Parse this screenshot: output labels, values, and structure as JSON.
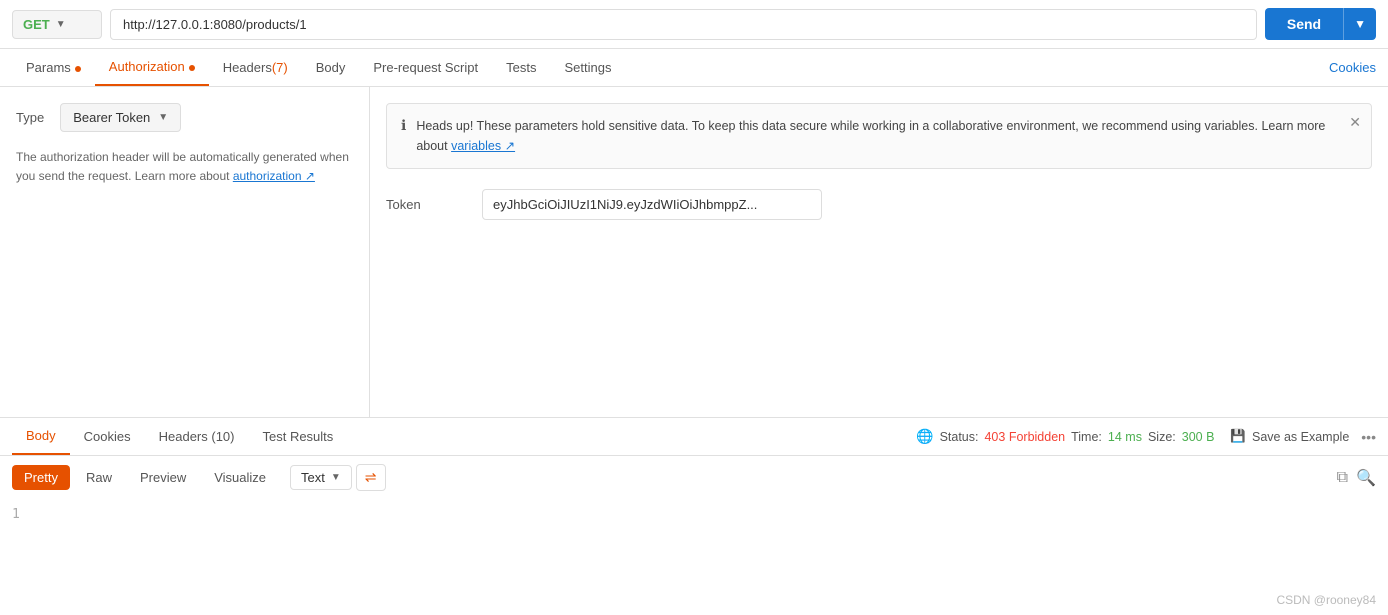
{
  "topbar": {
    "method": "GET",
    "url": "http://127.0.0.1:8080/products/1",
    "send_label": "Send"
  },
  "request_tabs": [
    {
      "id": "params",
      "label": "Params",
      "dot": "orange",
      "count": ""
    },
    {
      "id": "authorization",
      "label": "Authorization",
      "dot": "orange",
      "count": ""
    },
    {
      "id": "headers",
      "label": "Headers",
      "count": "(7)",
      "dot": ""
    },
    {
      "id": "body",
      "label": "Body",
      "dot": "",
      "count": ""
    },
    {
      "id": "prerequest",
      "label": "Pre-request Script",
      "dot": "",
      "count": ""
    },
    {
      "id": "tests",
      "label": "Tests",
      "dot": "",
      "count": ""
    },
    {
      "id": "settings",
      "label": "Settings",
      "dot": "",
      "count": ""
    }
  ],
  "cookies_link": "Cookies",
  "left_panel": {
    "type_label": "Type",
    "type_value": "Bearer Token",
    "description": "The authorization header will be automatically generated when you send the request. Learn more about ",
    "auth_link_text": "authorization ↗"
  },
  "info_banner": {
    "text_part1": "Heads up! These parameters hold sensitive data. To keep this data secure while working in a collaborative environment, we recommend using variables. Learn more about ",
    "link_text": "variables ↗"
  },
  "token_row": {
    "label": "Token",
    "value": "eyJhbGciOiJIUzI1NiJ9.eyJzdWIiOiJhbmppZ..."
  },
  "response": {
    "tabs": [
      {
        "id": "body",
        "label": "Body"
      },
      {
        "id": "cookies",
        "label": "Cookies"
      },
      {
        "id": "headers",
        "label": "Headers (10)"
      },
      {
        "id": "test_results",
        "label": "Test Results"
      }
    ],
    "status_label": "Status:",
    "status_value": "403 Forbidden",
    "time_label": "Time:",
    "time_value": "14 ms",
    "size_label": "Size:",
    "size_value": "300 B",
    "save_example": "Save as Example",
    "format_tabs": [
      "Pretty",
      "Raw",
      "Preview",
      "Visualize"
    ],
    "text_label": "Text",
    "line_number": "1"
  }
}
